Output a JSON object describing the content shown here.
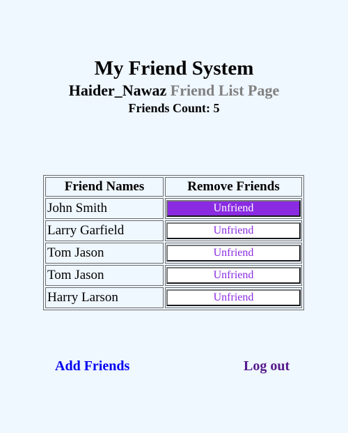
{
  "header": {
    "title": "My Friend System",
    "username": "Haider_Nawaz",
    "page_name": "Friend List Page",
    "friends_count_label": "Friends Count: 5"
  },
  "table": {
    "columns": [
      "Friend Names",
      "Remove Friends"
    ],
    "rows": [
      {
        "name": "John Smith",
        "action": "Unfriend"
      },
      {
        "name": "Larry Garfield",
        "action": "Unfriend"
      },
      {
        "name": "Tom Jason",
        "action": "Unfriend"
      },
      {
        "name": "Tom Jason",
        "action": "Unfriend"
      },
      {
        "name": "Harry Larson",
        "action": "Unfriend"
      }
    ]
  },
  "links": {
    "add_friends": "Add Friends",
    "log_out": "Log out"
  },
  "colors": {
    "background": "#eff7ff",
    "button_accent": "#8a2be2",
    "link_unvisited": "#0000ee",
    "link_visited": "#551a8b",
    "subtitle_gray": "#808080"
  }
}
